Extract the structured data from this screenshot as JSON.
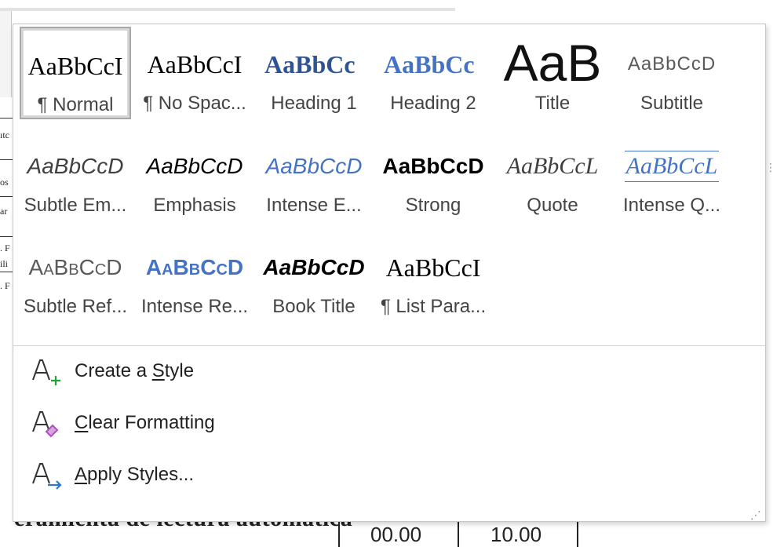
{
  "document": {
    "left_fragments": [
      "ıtc",
      "os",
      "ar",
      ". F",
      "ili",
      ". F"
    ],
    "bottom_text": "eramienta de lectura automatica",
    "cell_values": [
      "00.00",
      "10.00"
    ]
  },
  "styles_gallery": {
    "styles": [
      {
        "preview": "AaBbCcI",
        "name": "¶ Normal",
        "selected": true
      },
      {
        "preview": "AaBbCcI",
        "name": "¶ No Spac..."
      },
      {
        "preview": "AaBbCc",
        "name": "Heading 1"
      },
      {
        "preview": "AaBbCc",
        "name": "Heading 2"
      },
      {
        "preview": "AaB",
        "name": "Title"
      },
      {
        "preview": "AaBbCcD",
        "name": "Subtitle"
      },
      {
        "preview": "AaBbCcD",
        "name": "Subtle Em..."
      },
      {
        "preview": "AaBbCcD",
        "name": "Emphasis"
      },
      {
        "preview": "AaBbCcD",
        "name": "Intense E..."
      },
      {
        "preview": "AaBbCcD",
        "name": "Strong"
      },
      {
        "preview": "AaBbCcL",
        "name": "Quote"
      },
      {
        "preview": "AaBbCcL",
        "name": "Intense Q..."
      },
      {
        "preview": "AaBbCcD",
        "name": "Subtle Ref..."
      },
      {
        "preview": "AaBbCcD",
        "name": "Intense Re..."
      },
      {
        "preview": "AaBbCcD",
        "name": "Book Title"
      },
      {
        "preview": "AaBbCcI",
        "name": "¶ List Para..."
      }
    ],
    "menu": {
      "create_style": {
        "before": "Create a ",
        "key": "S",
        "after": "tyle",
        "icon": "create-style-icon"
      },
      "clear_formatting": {
        "before": "",
        "key": "C",
        "after": "lear Formatting",
        "icon": "clear-formatting-icon"
      },
      "apply_styles": {
        "before": "",
        "key": "A",
        "after": "pply Styles...",
        "icon": "apply-styles-icon"
      }
    },
    "resize_grip": "⋰"
  },
  "colors": {
    "heading1": "#2f5496",
    "accent_blue": "#4472c4",
    "create_plus_green": "#22a03a",
    "eraser_purple": "#b04fc0",
    "apply_arrow_blue": "#2e74d2"
  }
}
